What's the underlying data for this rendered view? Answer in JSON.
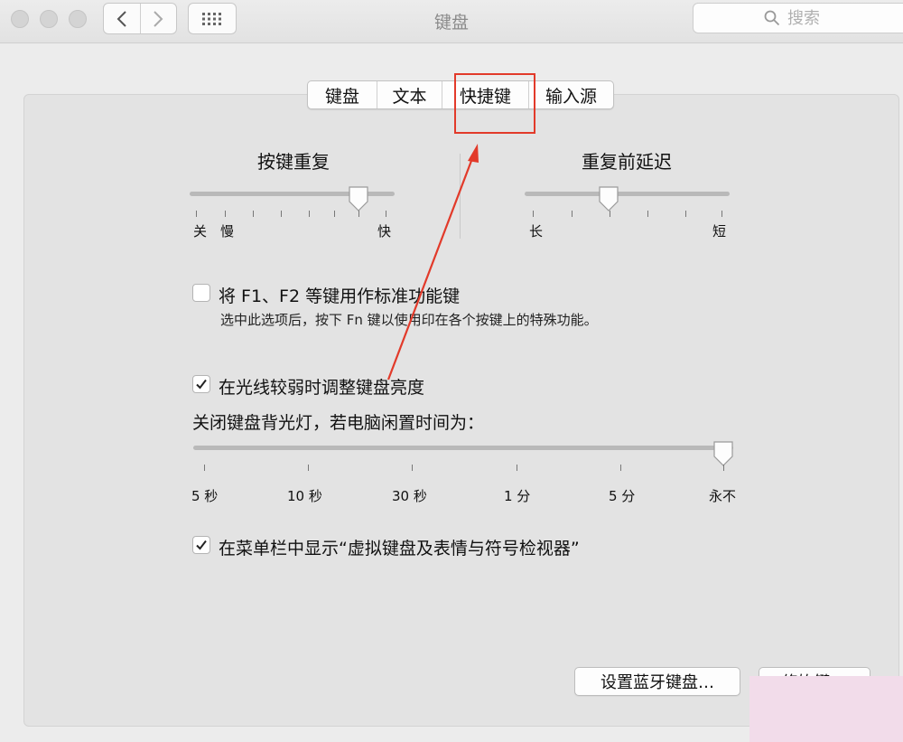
{
  "window": {
    "title": "键盘"
  },
  "search": {
    "placeholder": "搜索"
  },
  "tabs": [
    "键盘",
    "文本",
    "快捷键",
    "输入源"
  ],
  "key_repeat": {
    "heading": "按键重复",
    "labels": {
      "off": "关",
      "slow": "慢",
      "fast": "快"
    },
    "level": 0.82
  },
  "delay_until_repeat": {
    "heading": "重复前延迟",
    "labels": {
      "long": "长",
      "short": "短"
    },
    "level": 0.41
  },
  "fn_keys": {
    "checked": false,
    "label": "将 F1、F2 等键用作标准功能键",
    "description": "选中此选项后，按下 Fn 键以使用印在各个按键上的特殊功能。"
  },
  "auto_brightness": {
    "checked": true,
    "label": "在光线较弱时调整键盘亮度"
  },
  "backlight_off": {
    "label": "关闭键盘背光灯，若电脑闲置时间为：",
    "ticks": [
      "5 秒",
      "10 秒",
      "30 秒",
      "1 分",
      "5 分",
      "永不"
    ],
    "value": "永不"
  },
  "show_viewer": {
    "checked": true,
    "label": "在菜单栏中显示“虚拟键盘及表情与符号检视器”"
  },
  "buttons": {
    "bluetooth": "设置蓝牙键盘…",
    "modifier": "修饰键…"
  },
  "colors": {
    "annotation": "#e23a2a"
  }
}
